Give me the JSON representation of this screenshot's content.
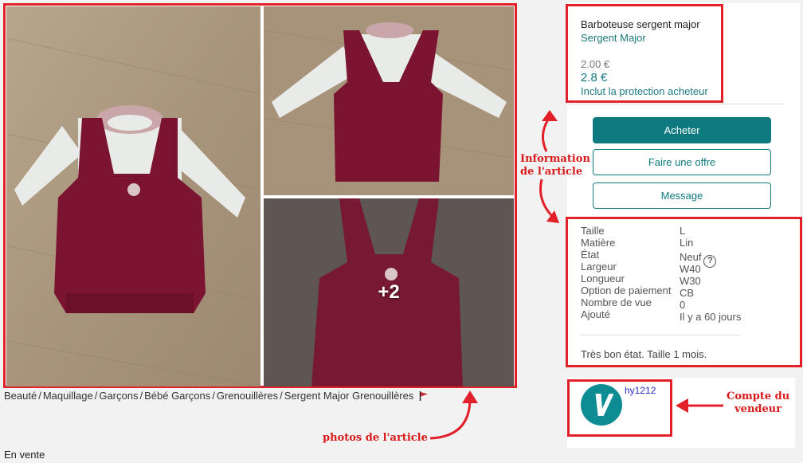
{
  "gallery": {
    "more_count": "+2"
  },
  "breadcrumb": {
    "items": [
      "Beauté",
      "Maquillage",
      "Garçons",
      "Bébé Garçons",
      "Grenouillères",
      "Sergent Major Grenouillères"
    ],
    "separator": "/"
  },
  "status": "En vente",
  "item": {
    "title": "Barboteuse sergent major",
    "brand": "Sergent Major",
    "old_price": "2.00 €",
    "price": "2.8 €",
    "protection": "Inclut la protection acheteur"
  },
  "actions": {
    "buy_label": "Acheter",
    "offer_label": "Faire une offre",
    "message_label": "Message"
  },
  "details": [
    {
      "key": "Taille",
      "value": "L"
    },
    {
      "key": "Matière",
      "value": "Lin"
    },
    {
      "key": "État",
      "value": "Neuf"
    },
    {
      "key": "Largeur",
      "value": "W40"
    },
    {
      "key": "Longueur",
      "value": "W30"
    },
    {
      "key": "Option de paiement",
      "value": "CB"
    },
    {
      "key": "Nombre de vue",
      "value": "0"
    },
    {
      "key": "Ajouté",
      "value": "Il y a 60 jours"
    }
  ],
  "description": "Très bon état. Taille 1 mois.",
  "seller": {
    "username": "hy1212",
    "avatar_letter": "V"
  },
  "annotations": {
    "info_line1": "Information",
    "info_line2": "de l'article",
    "seller_line1": "Compte du",
    "seller_line2": "vendeur",
    "photos": "photos de l'article"
  },
  "colors": {
    "accent": "#0e7a80",
    "annotation_red": "#e1202a",
    "garment_burgundy": "#7a1430"
  },
  "icons": [
    "flag-icon",
    "help-icon"
  ]
}
